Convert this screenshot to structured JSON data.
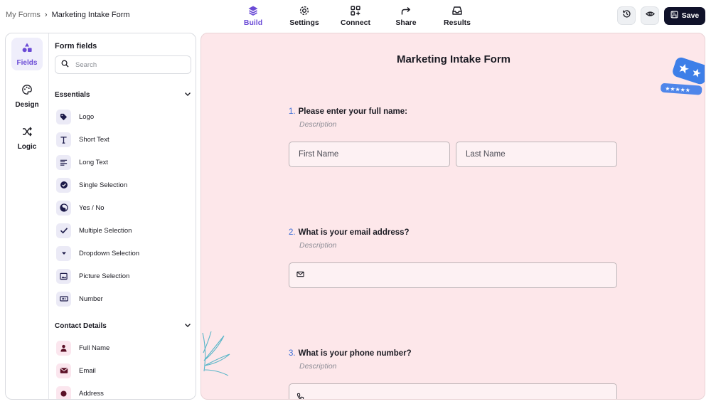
{
  "breadcrumb": {
    "root": "My Forms",
    "separator": "›",
    "current": "Marketing Intake Form"
  },
  "nav": {
    "tabs": [
      {
        "label": "Build",
        "icon": "layers-icon",
        "active": true
      },
      {
        "label": "Settings",
        "icon": "gear-icon",
        "active": false
      },
      {
        "label": "Connect",
        "icon": "grid-plus-icon",
        "active": false
      },
      {
        "label": "Share",
        "icon": "share-arrow-icon",
        "active": false
      },
      {
        "label": "Results",
        "icon": "inbox-icon",
        "active": false
      }
    ]
  },
  "actions": {
    "history_icon": "history-icon",
    "preview_icon": "eye-icon",
    "save_label": "Save"
  },
  "rail": {
    "items": [
      {
        "label": "Fields",
        "icon": "shapes-icon",
        "active": true
      },
      {
        "label": "Design",
        "icon": "palette-icon",
        "active": false
      },
      {
        "label": "Logic",
        "icon": "shuffle-icon",
        "active": false
      }
    ]
  },
  "fields_panel": {
    "title": "Form fields",
    "search_placeholder": "Search",
    "sections": [
      {
        "title": "Essentials",
        "items": [
          {
            "label": "Logo",
            "icon": "tag-icon"
          },
          {
            "label": "Short Text",
            "icon": "text-t-icon"
          },
          {
            "label": "Long Text",
            "icon": "align-left-icon"
          },
          {
            "label": "Single Selection",
            "icon": "check-circle-icon"
          },
          {
            "label": "Yes / No",
            "icon": "yin-yang-icon"
          },
          {
            "label": "Multiple Selection",
            "icon": "checkmark-icon"
          },
          {
            "label": "Dropdown Selection",
            "icon": "caret-down-icon"
          },
          {
            "label": "Picture Selection",
            "icon": "picture-icon"
          },
          {
            "label": "Number",
            "icon": "number-icon"
          }
        ]
      },
      {
        "title": "Contact Details",
        "items": [
          {
            "label": "Full Name",
            "icon": "person-icon"
          },
          {
            "label": "Email",
            "icon": "envelope-icon"
          },
          {
            "label": "Address",
            "icon": "location-icon"
          }
        ]
      }
    ]
  },
  "form": {
    "title": "Marketing Intake Form",
    "questions": [
      {
        "number": "1.",
        "text": "Please enter your full name:",
        "description": "Description",
        "inputs": [
          {
            "placeholder": "First Name"
          },
          {
            "placeholder": "Last Name"
          }
        ]
      },
      {
        "number": "2.",
        "text": "What is your email address?",
        "description": "Description",
        "inputs": [
          {
            "placeholder": "",
            "icon": "envelope-icon"
          }
        ]
      },
      {
        "number": "3.",
        "text": "What is your phone number?",
        "description": "Description",
        "inputs": [
          {
            "placeholder": "",
            "icon": "phone-icon"
          }
        ]
      }
    ]
  },
  "colors": {
    "accent": "#6b4bd6",
    "question_number": "#3d6fd8",
    "canvas_bg": "#fde7ea",
    "save_button_bg": "#10122a",
    "contact_icon": "#5a1026"
  }
}
